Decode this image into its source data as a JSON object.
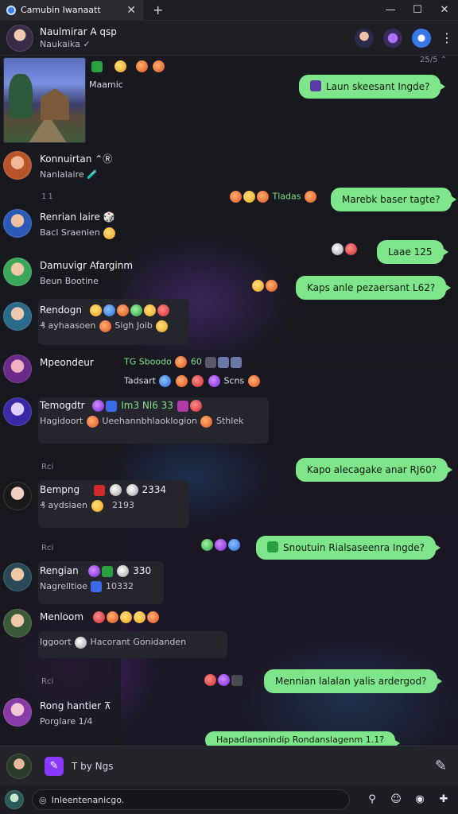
{
  "titlebar": {
    "tab_title": "Camubin Iwanaatt",
    "close_glyph": "✕",
    "new_tab_glyph": "+",
    "minimize_glyph": "—",
    "maximize_glyph": "☐",
    "window_close_glyph": "✕"
  },
  "header": {
    "name": "Naulmirar  A̵  qsp",
    "status": "Naukaika ✓",
    "more_glyph": "⋮"
  },
  "timestamps": {
    "top": "25/5 ⌃",
    "t1": "1 1",
    "t2": "Rci",
    "t3": "Rci",
    "t4": "Rci"
  },
  "thumb_caption": "Maamic",
  "contacts": [
    {
      "name": "Konnuirtan",
      "extra": "⌃Ⓡ",
      "preview": "Nanlalaire 🧪"
    },
    {
      "name": "Renrian laire",
      "extra": "🎲",
      "preview": "Bacl Sraenien"
    },
    {
      "name": "Damuvigr Afarginm",
      "extra": "",
      "preview": "Beun Bootine"
    },
    {
      "name": "Rendogn",
      "extra": "",
      "preview": "₰ ayhaasoen"
    },
    {
      "name": "Mpeondeur",
      "extra": "",
      "preview": ""
    },
    {
      "name": "Temogdtr",
      "extra": "",
      "preview": "Hagidoort"
    },
    {
      "name": "Bempng",
      "extra": "",
      "preview": "₰ aydsiaen"
    },
    {
      "name": "Rengian",
      "extra": "",
      "preview": "Nagrelltioe"
    },
    {
      "name": "Menloom",
      "extra": "",
      "preview": "Iggoort"
    },
    {
      "name": "Rong hantier",
      "extra": "⊼",
      "preview": "Porglare 1/4"
    }
  ],
  "incoming_lines": {
    "rendogn_tail": "Sigh Joib",
    "mpeondeur_codes": "TG   Sboodo",
    "mpeondeur_nums": "60",
    "mpeondeur_line2a": "Tadsart",
    "mpeondeur_line2b": "Scns",
    "temogdtr_codes": "Im3  Nl6  33",
    "temogdtr_line2": "Ueehannbhlaoklogion",
    "temogdtr_tail": "Sthlek",
    "bempng_code": "2334",
    "bempng_code2": "2193",
    "rengian_code": "330",
    "rengian_code2": "10332",
    "menloom_line2": "Hacorant Gonidanden",
    "near_top": "Tladas"
  },
  "outgoing": [
    {
      "text": "Laun skeesant Ingde?"
    },
    {
      "text": "Marebk baser tagte?"
    },
    {
      "text": "Laae 125"
    },
    {
      "text": "Kaps anle pezaersant L62?"
    },
    {
      "text": "Kapo alecagake anar RJ60?"
    },
    {
      "text": "Snoutuin Rialsaseenra Ingde?"
    },
    {
      "text": "Mennian lalalan yalis ardergod?"
    },
    {
      "text": "Hapadlansnindip Rondanslagenm 1.1?"
    }
  ],
  "compose": {
    "text": "T by  Ngs",
    "pen_glyph": "✎"
  },
  "input": {
    "placeholder": "Inleentenanicgo.",
    "icon_glyph": "◎"
  },
  "colors": {
    "accent_green": "#7fe58a",
    "app_purple": "#8a3aff",
    "bg": "#15161b"
  },
  "icons": [
    "app-logo-icon",
    "close-icon",
    "plus-icon",
    "minimize-icon",
    "maximize-icon",
    "more-icon",
    "pencil-icon",
    "emoji-icon",
    "sticker-icon",
    "camera-icon",
    "add-icon",
    "attach-icon"
  ]
}
